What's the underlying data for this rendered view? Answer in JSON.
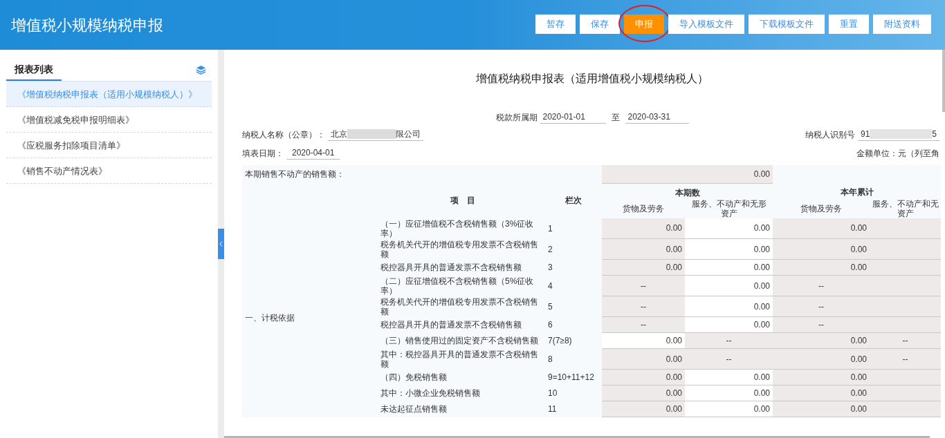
{
  "header": {
    "title": "增值税小规模纳税申报",
    "buttons": [
      {
        "label": "暂存",
        "primary": false,
        "circled": false
      },
      {
        "label": "保存",
        "primary": false,
        "circled": false
      },
      {
        "label": "申报",
        "primary": true,
        "circled": true
      },
      {
        "label": "导入模板文件",
        "primary": false,
        "circled": false
      },
      {
        "label": "下载模板文件",
        "primary": false,
        "circled": false
      },
      {
        "label": "重置",
        "primary": false,
        "circled": false
      },
      {
        "label": "附送资料",
        "primary": false,
        "circled": false
      }
    ]
  },
  "sidebar": {
    "tab": "报表列表",
    "items": [
      {
        "label": "《增值税纳税申报表（适用小规模纳税人）》",
        "selected": true
      },
      {
        "label": "《增值税减免税申报明细表》",
        "selected": false
      },
      {
        "label": "《应税服务扣除项目清单》",
        "selected": false
      },
      {
        "label": "《销售不动产情况表》",
        "selected": false
      }
    ]
  },
  "form": {
    "title": "增值税纳税申报表（适用增值税小规模纳税人）",
    "period_label": "税款所属期",
    "period_from": "2020-01-01",
    "period_sep": "至",
    "period_to": "2020-03-31",
    "name_label": "纳税人名称（公章）：",
    "name_prefix": "北京",
    "name_suffix": "限公司",
    "id_label": "纳税人识别号",
    "id_prefix": "91",
    "id_suffix": "5",
    "date_label": "填表日期：",
    "date": "2020-04-01",
    "unit": "金额单位：元（列至角",
    "realestate_label": "本期销售不动产的销售额：",
    "realestate_value": "0.00",
    "columns": {
      "item": "项　目",
      "line": "栏次",
      "period": "本期数",
      "year": "本年累计",
      "goods": "货物及劳务",
      "services": "服务、不动产和无形资产",
      "goods2": "货物及劳务",
      "services2": "服务、不动产和无",
      "services2_line2": "资产"
    },
    "section": "一、计税依据",
    "rows": [
      {
        "item": "（一）应征增值税不含税销售额（3%征收率）",
        "line": "1",
        "cells": [
          {
            "text": "0.00",
            "shaded": true
          },
          {
            "text": "0.00",
            "shaded": false
          },
          {
            "text": "0.00",
            "shaded": true
          },
          {
            "shaded": true
          }
        ]
      },
      {
        "item": "税务机关代开的增值税专用发票不含税销售额",
        "line": "2",
        "cells": [
          {
            "text": "0.00",
            "shaded": true
          },
          {
            "text": "0.00",
            "shaded": false
          },
          {
            "text": "0.00",
            "shaded": true
          },
          {
            "shaded": true
          }
        ]
      },
      {
        "item": "税控器具开具的普通发票不含税销售额",
        "line": "3",
        "cells": [
          {
            "text": "0.00",
            "shaded": true
          },
          {
            "text": "0.00",
            "shaded": false
          },
          {
            "text": "0.00",
            "shaded": true
          },
          {
            "shaded": true
          }
        ]
      },
      {
        "item": "（二）应征增值税不含税销售额（5%征收率）",
        "line": "4",
        "cells": [
          {
            "text": "--",
            "shaded": true
          },
          {
            "text": "0.00",
            "shaded": false
          },
          {
            "text": "--",
            "shaded": true
          },
          {
            "shaded": true
          }
        ]
      },
      {
        "item": "税务机关代开的增值税专用发票不含税销售额",
        "line": "5",
        "cells": [
          {
            "text": "--",
            "shaded": true
          },
          {
            "text": "0.00",
            "shaded": false
          },
          {
            "text": "--",
            "shaded": true
          },
          {
            "shaded": true
          }
        ]
      },
      {
        "item": "税控器具开具的普通发票不含税销售额",
        "line": "6",
        "cells": [
          {
            "text": "--",
            "shaded": true
          },
          {
            "text": "0.00",
            "shaded": false
          },
          {
            "text": "--",
            "shaded": true
          },
          {
            "shaded": true
          }
        ]
      },
      {
        "item": "（三）销售使用过的固定资产不含税销售额",
        "line": "7(7≥8)",
        "cells": [
          {
            "text": "0.00",
            "shaded": false
          },
          {
            "text": "--",
            "shaded": true
          },
          {
            "text": "0.00",
            "shaded": true
          },
          {
            "text": "--",
            "shaded": true
          }
        ]
      },
      {
        "item": "其中：税控器具开具的普通发票不含税销售额",
        "line": "8",
        "cells": [
          {
            "text": "0.00",
            "shaded": true
          },
          {
            "text": "--",
            "shaded": true
          },
          {
            "text": "0.00",
            "shaded": true
          },
          {
            "text": "--",
            "shaded": true
          }
        ]
      },
      {
        "item": "（四）免税销售额",
        "line": "9=10+11+12",
        "cells": [
          {
            "text": "0.00",
            "shaded": true
          },
          {
            "text": "0.00",
            "shaded": false
          },
          {
            "text": "0.00",
            "shaded": true
          },
          {
            "shaded": true
          }
        ]
      },
      {
        "item": "其中：小微企业免税销售额",
        "line": "10",
        "cells": [
          {
            "text": "0.00",
            "shaded": true
          },
          {
            "text": "0.00",
            "shaded": false
          },
          {
            "text": "0.00",
            "shaded": true
          },
          {
            "shaded": true
          }
        ]
      },
      {
        "item": "未达起征点销售额",
        "line": "11",
        "cells": [
          {
            "text": "0.00",
            "shaded": true
          },
          {
            "text": "0.00",
            "shaded": false
          },
          {
            "text": "0.00",
            "shaded": true
          },
          {
            "shaded": true
          }
        ]
      }
    ]
  }
}
